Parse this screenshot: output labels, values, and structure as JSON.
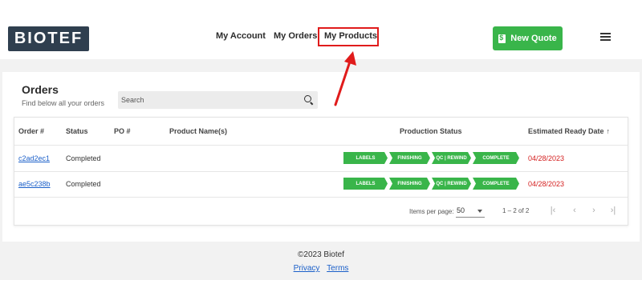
{
  "header": {
    "logo": "BIOTEF",
    "nav": {
      "account": "My Account",
      "orders": "My Orders",
      "products": "My Products"
    },
    "new_quote_label": "New Quote",
    "accent_color": "#39b54a"
  },
  "orders": {
    "title": "Orders",
    "subtitle": "Find below all your orders",
    "search": {
      "placeholder": "Search",
      "value": ""
    },
    "columns": {
      "order": "Order #",
      "status": "Status",
      "po": "PO #",
      "product": "Product Name(s)",
      "production": "Production Status",
      "date": "Estimated Ready Date"
    },
    "rows": [
      {
        "order_id": "c2ad2ec1",
        "status": "Completed",
        "po": "",
        "product": "",
        "stages": [
          "LABELS",
          "FINISHING",
          "QC | REWIND",
          "COMPLETE"
        ],
        "date": "04/28/2023"
      },
      {
        "order_id": "ae5c238b",
        "status": "Completed",
        "po": "",
        "product": "",
        "stages": [
          "LABELS",
          "FINISHING",
          "QC | REWIND",
          "COMPLETE"
        ],
        "date": "04/28/2023"
      }
    ],
    "pagination": {
      "items_label": "Items per page:",
      "page_size": "50",
      "range": "1 – 2 of 2"
    }
  },
  "footer": {
    "copyright": "©2023 Biotef",
    "privacy": "Privacy",
    "terms": "Terms"
  },
  "annotation_color": "#e01b1b"
}
